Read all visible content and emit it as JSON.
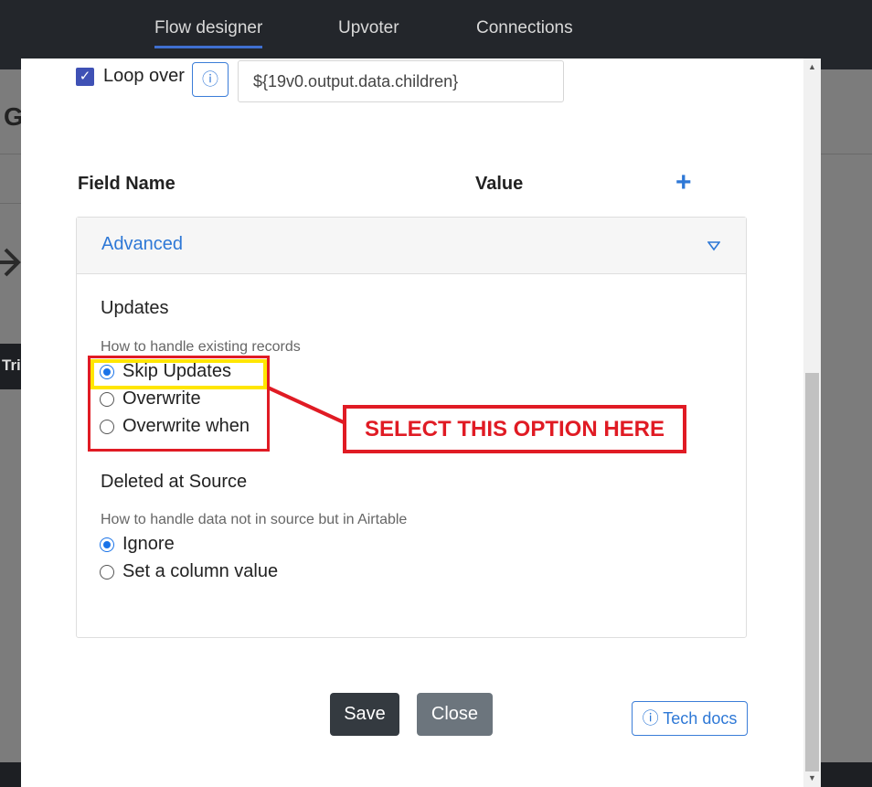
{
  "nav": {
    "tabs": [
      "Flow designer",
      "Upvoter",
      "Connections"
    ]
  },
  "background": {
    "page_letter": "G",
    "trigger_label": "Tri"
  },
  "modal": {
    "loop": {
      "checked": true,
      "label": "Loop over",
      "info_icon": "ⓘ",
      "value": "${19v0.output.data.children}"
    },
    "table_header": {
      "field_name": "Field Name",
      "value": "Value",
      "add_icon": "+"
    },
    "advanced": {
      "title": "Advanced",
      "updates": {
        "title": "Updates",
        "hint": "How to handle existing records",
        "options": [
          "Skip Updates",
          "Overwrite",
          "Overwrite when"
        ],
        "selected": "Skip Updates"
      },
      "deleted": {
        "title": "Deleted at Source",
        "hint": "How to handle data not in source but in Airtable",
        "options": [
          "Ignore",
          "Set a column value"
        ],
        "selected": "Ignore"
      }
    },
    "buttons": {
      "save": "Save",
      "close": "Close",
      "tech_docs": "ⓘ Tech docs"
    }
  },
  "annotation": {
    "callout": "SELECT THIS OPTION HERE",
    "color": "#e01b24",
    "highlight_color": "#ffe600"
  },
  "colors": {
    "accent": "#2e78d6",
    "checkbox": "#3f51b5",
    "save_button": "#343a40",
    "close_button": "#6c757d"
  }
}
